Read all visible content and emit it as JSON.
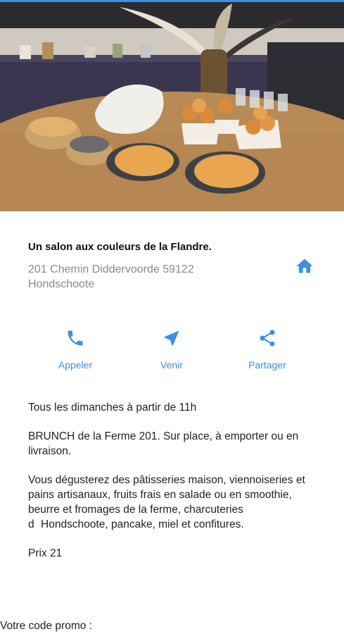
{
  "listing": {
    "title": "Un salon aux couleurs de la Flandre.",
    "address_line1": "201 Chemin Diddervoorde 59122",
    "address_line2": "Hondschoote"
  },
  "actions": {
    "call_label": "Appeler",
    "directions_label": "Venir",
    "share_label": "Partager"
  },
  "description": {
    "line1": "Tous les dimanches à partir de 11h",
    "line2": "BRUNCH de la Ferme 201. Sur place, à emporter ou en livraison.",
    "line3": "Vous dégusterez des pâtisseries maison, viennoiseries et pains artisanaux, fruits frais en salade ou en smoothie, beurre et fromages de la ferme, charcuteries dHondschoote, pancake, miel et confitures.",
    "price": "Prix 21"
  },
  "promo": {
    "label": "Votre code promo :"
  },
  "colors": {
    "accent": "#3d8fe6",
    "muted_text": "#8a8a8a"
  },
  "icons": {
    "home": "home-icon",
    "call": "phone-icon",
    "directions": "navigation-arrow-icon",
    "share": "share-icon"
  }
}
